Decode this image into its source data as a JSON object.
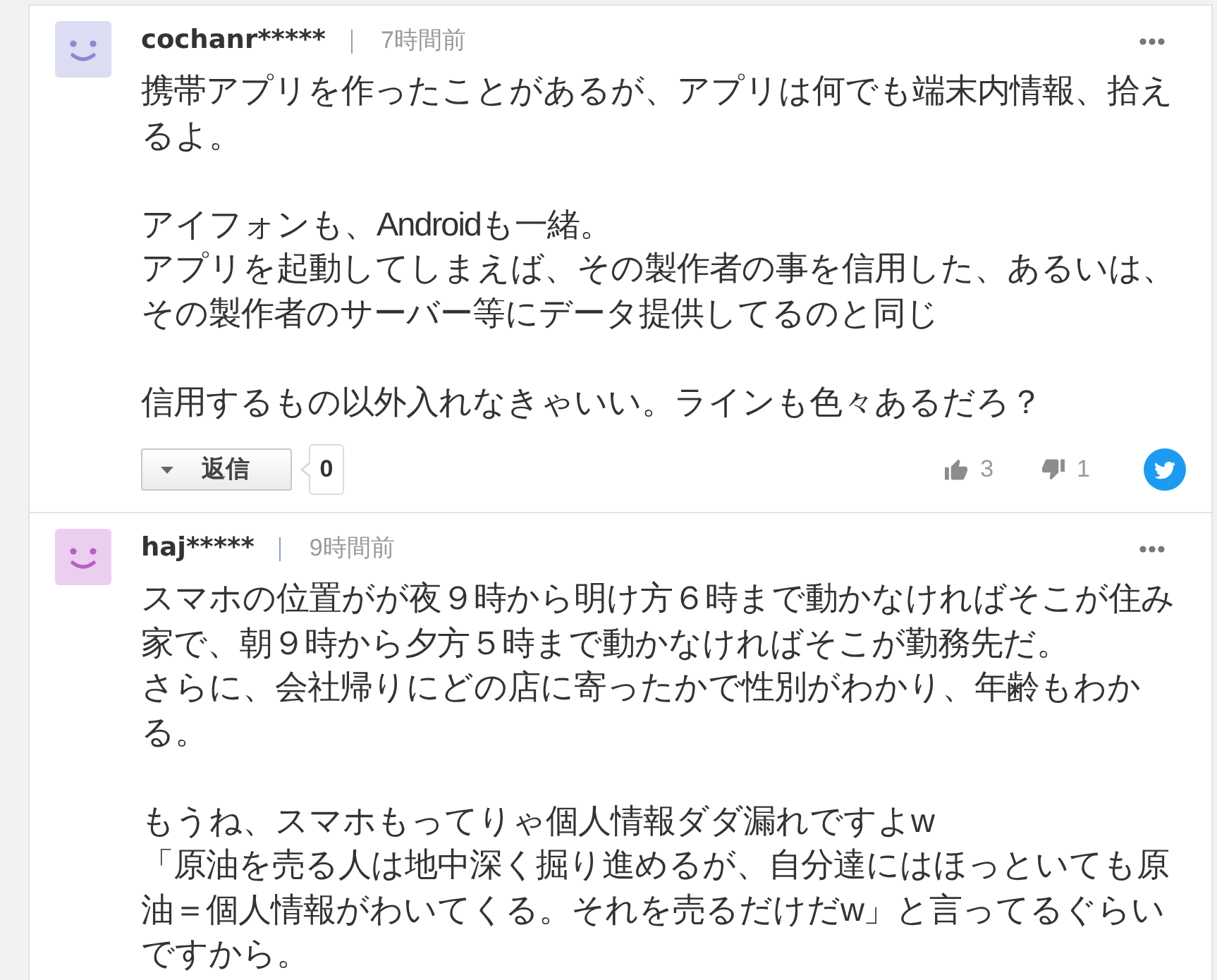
{
  "comments": [
    {
      "user": "cochanr*****",
      "time": "7時間前",
      "color": "#dcdcf2",
      "paragraphs": [
        [
          "携帯アプリを作ったことがあるが、アプリは何でも端末内情報、拾えるよ。"
        ],
        [
          "アイフォンも、Androidも一緒。",
          "アプリを起動してしまえば、その製作者の事を信用した、あるいは、その製作者のサーバー等にデータ提供してるのと同じ"
        ],
        [
          "信用するもの以外入れなきゃいい。ラインも色々あるだろ？"
        ]
      ],
      "actions": {
        "reply_label": "返信",
        "reply_count": "0",
        "likes": "3",
        "dislikes": "1"
      }
    },
    {
      "user": "haj*****",
      "time": "9時間前",
      "color": "#ead0ee",
      "paragraphs": [
        [
          "スマホの位置がが夜９時から明け方６時まで動かなければそこが住み家で、朝９時から夕方５時まで動かなければそこが勤務先だ。",
          "さらに、会社帰りにどの店に寄ったかで性別がわかり、年齢もわかる。"
        ],
        [
          "もうね、スマホもってりゃ個人情報ダダ漏れですよw",
          "「原油を売る人は地中深く掘り進めるが、自分達にはほっといても原油＝個人情報がわいてくる。それを売るだけだw」と言ってるぐらいですから。"
        ]
      ]
    }
  ]
}
